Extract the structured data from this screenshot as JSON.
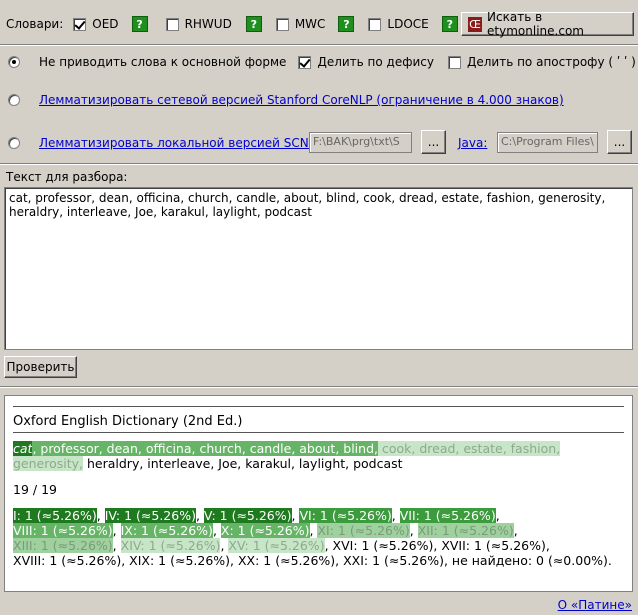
{
  "dictionaries": {
    "label": "Словари:",
    "items": [
      {
        "name": "OED",
        "checked": true
      },
      {
        "name": "RHWUD",
        "checked": false
      },
      {
        "name": "MWC",
        "checked": false
      },
      {
        "name": "LDOCE",
        "checked": false
      }
    ],
    "help_label": "?",
    "etymonline_button": "Искать в etymonline.com",
    "etymonline_logo": "Œ"
  },
  "options": {
    "no_lemma_label": "Не приводить слова к основной форме",
    "split_hyphen_label": "Делить по дефису",
    "split_hyphen_checked": true,
    "split_apostrophe_label": "Делить по апострофу ( ʹ ʹ )",
    "split_apostrophe_checked": false,
    "stanford_online_link": "Лемматизировать сетевой версией Stanford CoreNLP (ограничение в 4.000 знаков)",
    "scnlp_local_link": "Лемматизировать локальной версией SCNLP:",
    "scnlp_path": "F:\\BAK\\prg\\txt\\S",
    "java_link": "Java:",
    "java_path": "C:\\Program Files\\",
    "browse_label": "..."
  },
  "text_section": {
    "label": "Текст для разбора:",
    "value": "cat, professor, dean, officina, church, candle, about, blind, cook, dread, estate, fashion, generosity, heraldry, interleave, Joe, karakul, laylight, podcast",
    "check_button": "Проверить"
  },
  "results": {
    "dictionary_title": "Oxford English Dictionary (2nd Ed.)",
    "words_hl1": "cat",
    "words_hl2": ", professor, dean, officina, church, candle, about, blind,",
    "words_hl4a": " cook, dread, estate, fashion,",
    "words_hl4b": "generosity,",
    "words_plain": " heraldry, interleave, Joe, karakul, laylight, podcast",
    "count": "19 / 19",
    "stats_line1": [
      {
        "text": "I: 1 (≈5.26%)",
        "level": 1
      },
      {
        "text": ", ",
        "level": 0
      },
      {
        "text": "IV: 1 (≈5.26%)",
        "level": 1
      },
      {
        "text": ", ",
        "level": 0
      },
      {
        "text": "V: 1 (≈5.26%)",
        "level": 1
      },
      {
        "text": ", ",
        "level": 0
      },
      {
        "text": "VI: 1 (≈5.26%)",
        "level": 2
      },
      {
        "text": ", ",
        "level": 0
      },
      {
        "text": "VII: 1 (≈5.26%)",
        "level": 2
      },
      {
        "text": ",",
        "level": 0
      }
    ],
    "stats_line2": [
      {
        "text": "VIII: 1 (≈5.26%)",
        "level": 3
      },
      {
        "text": ", ",
        "level": 0
      },
      {
        "text": "IX: 1 (≈5.26%)",
        "level": 3
      },
      {
        "text": ", ",
        "level": 0
      },
      {
        "text": "X: 1 (≈5.26%)",
        "level": 3
      },
      {
        "text": ", ",
        "level": 0
      },
      {
        "text": "XI: 1 (≈5.26%)",
        "level": 4
      },
      {
        "text": ", ",
        "level": 0
      },
      {
        "text": "XII: 1 (≈5.26%)",
        "level": 4
      },
      {
        "text": ",",
        "level": 0
      }
    ],
    "stats_line3": [
      {
        "text": "XIII: 1 (≈5.26%)",
        "level": 4
      },
      {
        "text": ", ",
        "level": 0
      },
      {
        "text": "XIV: 1 (≈5.26%)",
        "level": 5
      },
      {
        "text": ", ",
        "level": 0
      },
      {
        "text": "XV: 1 (≈5.26%)",
        "level": 5
      },
      {
        "text": ", XVI: 1 (≈5.26%), XVII: 1 (≈5.26%),",
        "level": 0
      }
    ],
    "stats_line4": "XVIII: 1 (≈5.26%), XIX: 1 (≈5.26%), XX: 1 (≈5.26%), XXI: 1 (≈5.26%), не найдено: 0 (≈0.00%)."
  },
  "footer_link": "О «Патине»"
}
